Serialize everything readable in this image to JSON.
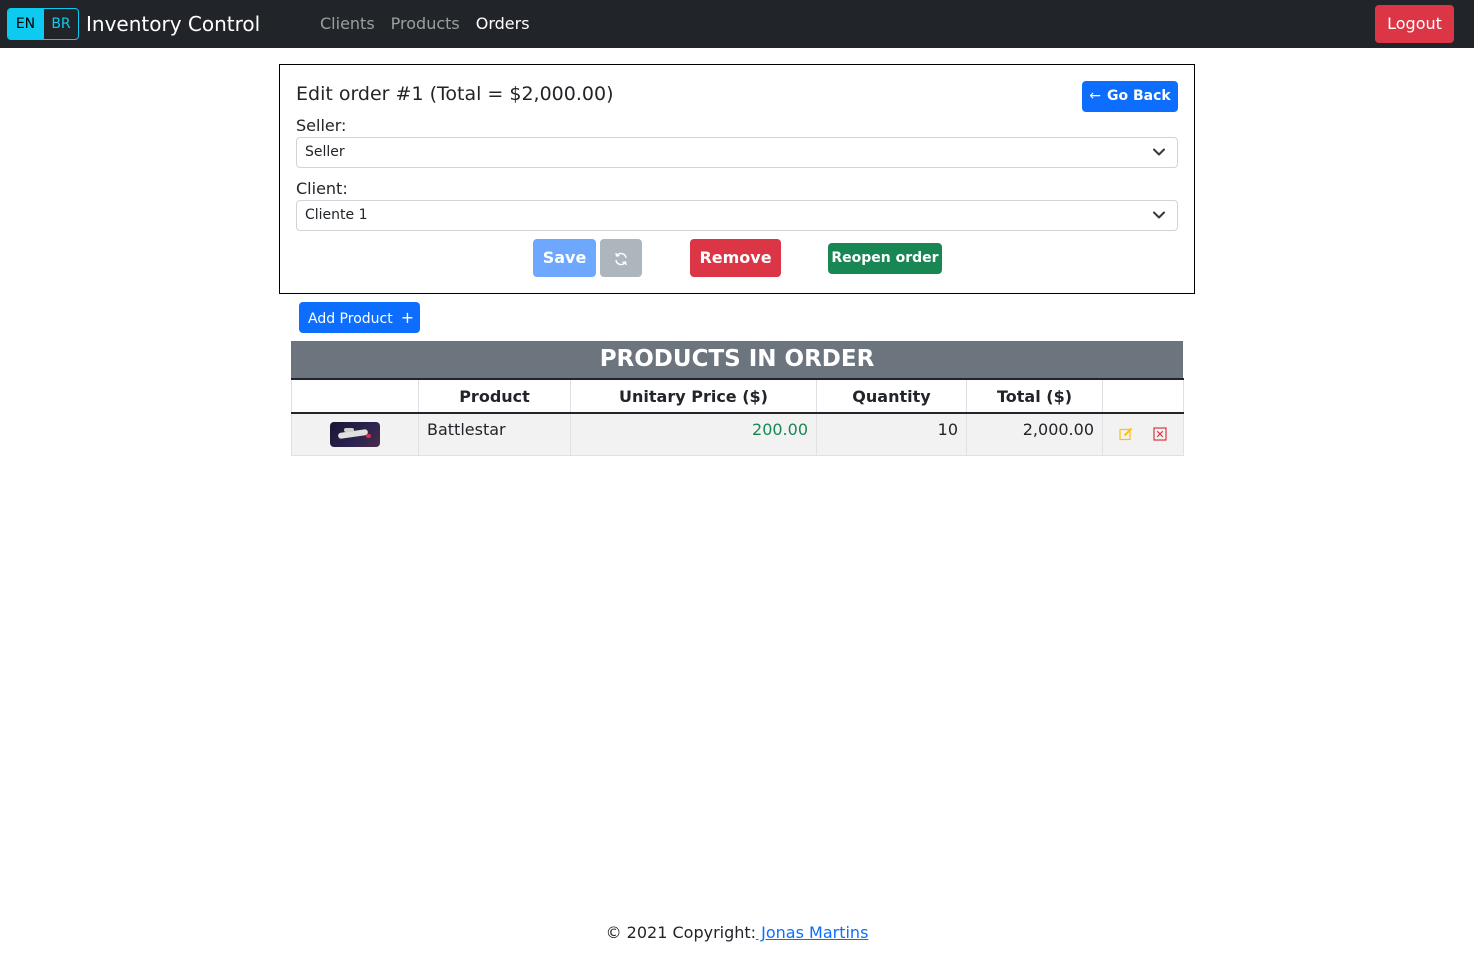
{
  "nav": {
    "lang_en": "EN",
    "lang_br": "BR",
    "brand": "Inventory Control",
    "links": [
      "Clients",
      "Products",
      "Orders"
    ],
    "active_link": "Orders",
    "logout": "Logout"
  },
  "edit": {
    "title": "Edit order #1 (Total = $2,000.00)",
    "go_back": "Go Back",
    "seller_label": "Seller:",
    "seller_value": "Seller",
    "client_label": "Client:",
    "client_value": "Cliente 1",
    "save": "Save",
    "remove": "Remove",
    "reopen": "Reopen order"
  },
  "add_product": "Add Product",
  "table": {
    "caption": "PRODUCTS IN ORDER",
    "headers": [
      "",
      "Product",
      "Unitary Price ($)",
      "Quantity",
      "Total ($)",
      ""
    ],
    "rows": [
      {
        "image": "battlestar-thumbnail",
        "product": "Battlestar",
        "price": "200.00",
        "quantity": "10",
        "total": "2,000.00"
      }
    ]
  },
  "footer": {
    "text": "© 2021 Copyright:",
    "author": " Jonas Martins"
  },
  "colors": {
    "navbar": "#212529",
    "primary": "#0d6efd",
    "danger": "#dc3545",
    "success": "#198754",
    "info": "#0dcaf0",
    "secondary": "#6c757d",
    "warning": "#ffc107"
  }
}
